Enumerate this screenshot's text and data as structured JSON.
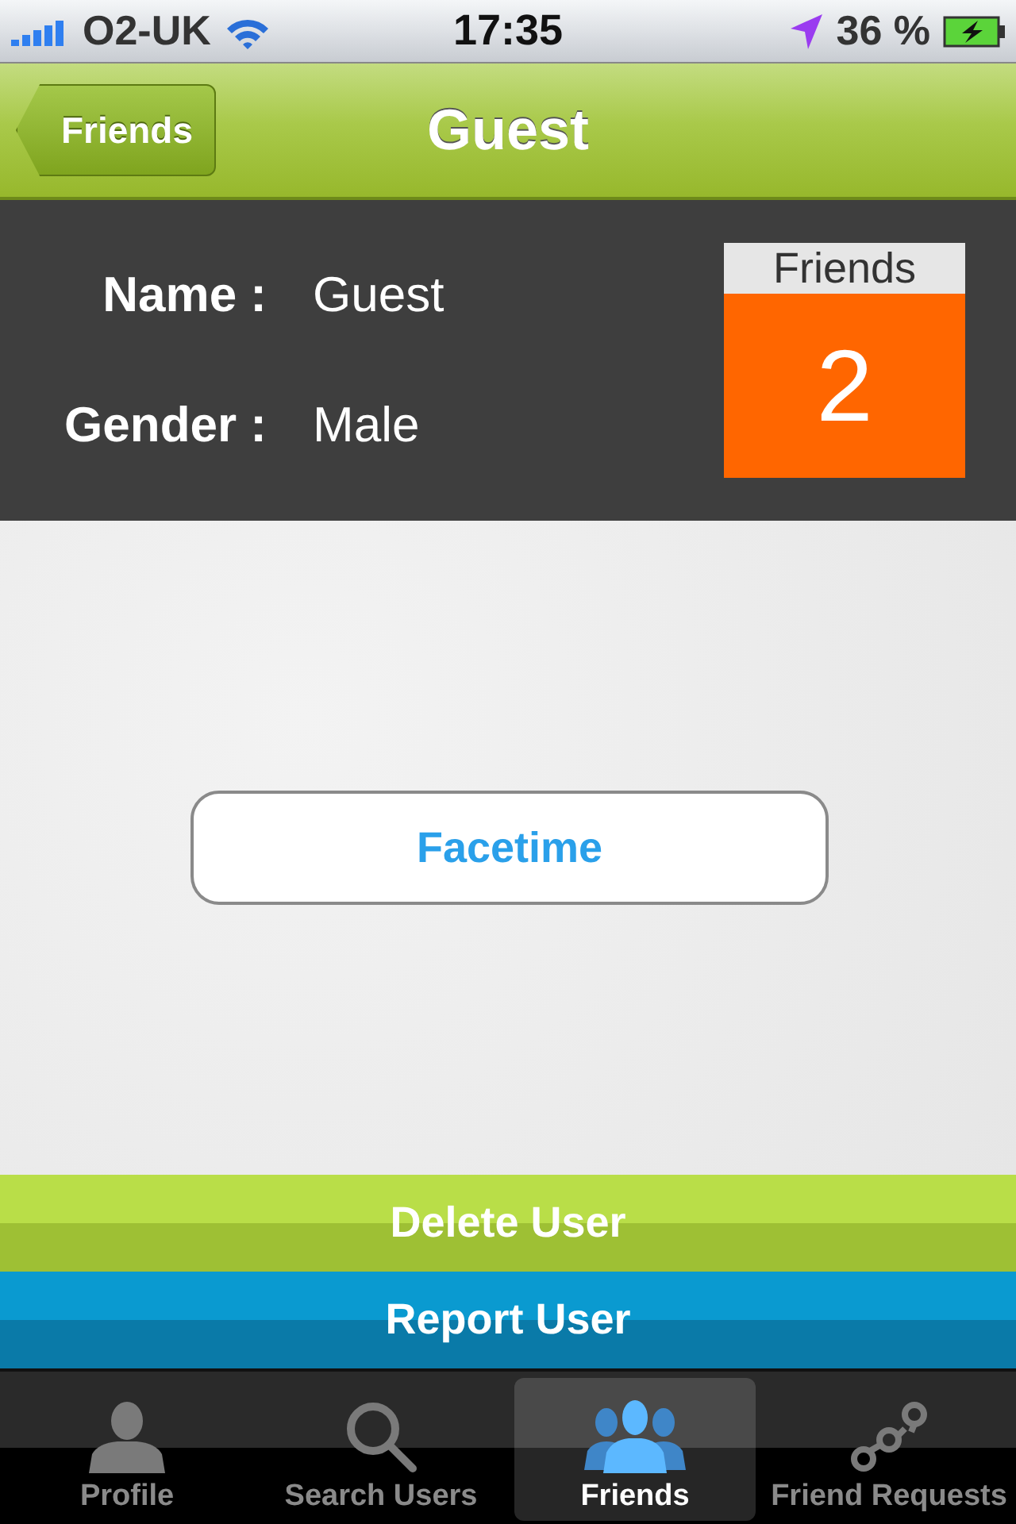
{
  "status_bar": {
    "carrier": "O2-UK",
    "time": "17:35",
    "battery": "36 %"
  },
  "nav": {
    "back": "Friends",
    "title": "Guest"
  },
  "profile": [
    {
      "label": "Name :",
      "value": "Guest"
    },
    {
      "label": "Gender :",
      "value": "Male"
    }
  ],
  "friends_count": {
    "label": "Friends",
    "count": "2"
  },
  "facetime_button": "Facetime",
  "actions": [
    {
      "label": "Delete User",
      "kind": "delete"
    },
    {
      "label": "Report User",
      "kind": "report"
    }
  ],
  "tabs": [
    {
      "label": "Profile",
      "kind": "person",
      "selected": false
    },
    {
      "label": "Search Users",
      "kind": "search",
      "selected": false
    },
    {
      "label": "Friends",
      "kind": "group",
      "selected": true
    },
    {
      "label": "Friend Requests",
      "kind": "chain",
      "selected": false
    }
  ]
}
